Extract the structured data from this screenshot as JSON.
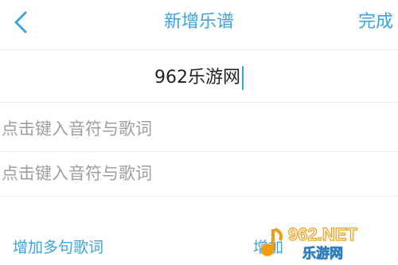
{
  "header": {
    "title": "新增乐谱",
    "done_label": "完成",
    "back_icon": "chevron-left-icon"
  },
  "score_name": {
    "value": "962乐游网"
  },
  "lyric_rows": [
    {
      "placeholder": "点击键入音符与歌词"
    },
    {
      "placeholder": "点击键入音符与歌词"
    }
  ],
  "footer": {
    "add_lyrics_label": "增加多句歌词",
    "add_right_label": "增加"
  },
  "watermark": {
    "text_top": "962.NET",
    "text_bottom": "乐游网"
  },
  "colors": {
    "accent": "#3aa3e3",
    "placeholder": "#9e9e9e",
    "divider": "#ececec"
  }
}
